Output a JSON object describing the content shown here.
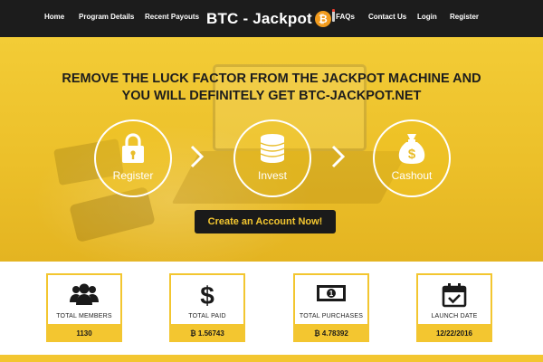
{
  "nav": {
    "home": "Home",
    "program_details": "Program Details",
    "recent_payouts": "Recent Payouts",
    "brand": "BTC - Jackpot",
    "brand_coin": "₿",
    "faqs": "FAQs",
    "contact_us": "Contact Us",
    "login": "Login",
    "register": "Register"
  },
  "hero": {
    "headline_line1": "REMOVE THE LUCK FACTOR FROM THE JACKPOT MACHINE AND",
    "headline_line2": "YOU WILL DEFINITELY GET BTC-JACKPOT.NET",
    "steps": [
      {
        "label": "Register",
        "icon": "lock-icon"
      },
      {
        "label": "Invest",
        "icon": "coins-icon"
      },
      {
        "label": "Cashout",
        "icon": "money-bag-icon"
      }
    ],
    "cta": "Create an Account Now!"
  },
  "stats": [
    {
      "label": "TOTAL MEMBERS",
      "value": "1130",
      "icon": "users-icon"
    },
    {
      "label": "TOTAL PAID",
      "value": "₿ 1.56743",
      "icon": "dollar-icon"
    },
    {
      "label": "TOTAL PURCHASES",
      "value": "₿ 4.78392",
      "icon": "banknote-icon"
    },
    {
      "label": "LAUNCH DATE",
      "value": "12/22/2016",
      "icon": "calendar-check-icon"
    }
  ],
  "colors": {
    "nav_bg": "#1c1c1c",
    "accent_yellow": "#f3c630",
    "cta_bg": "#1a1a1a",
    "coin_orange": "#f29b1d"
  }
}
